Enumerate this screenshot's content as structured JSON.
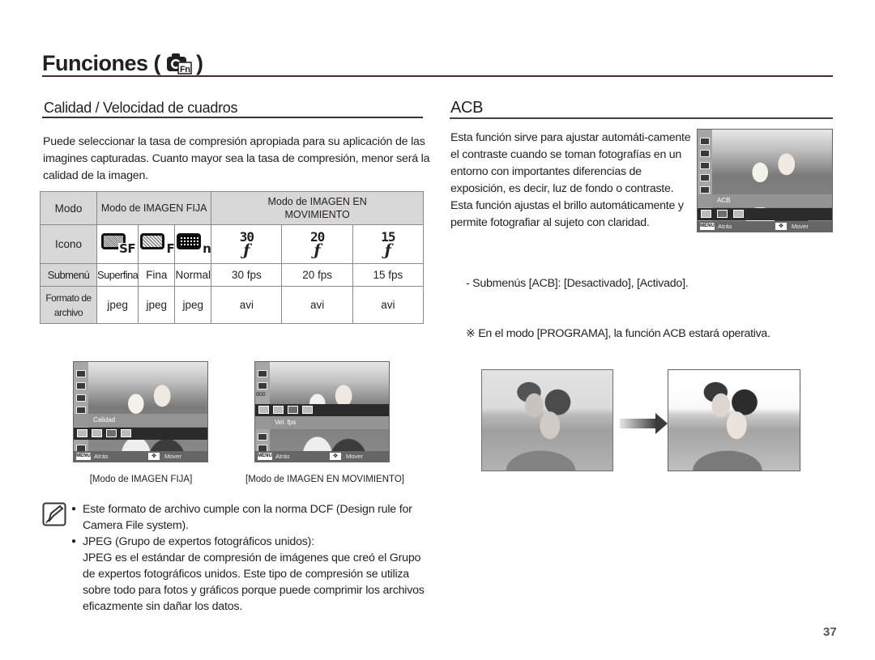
{
  "header": {
    "title": "Funciones (",
    "title_close": ")",
    "icon": "camera-fn-icon"
  },
  "section_quality": {
    "title": "Calidad / Velocidad de cuadros",
    "intro": "Puede seleccionar la tasa de compresión apropiada para su aplicación de las imagines capturadas. Cuanto mayor sea la tasa de compresión, menor será la calidad de la imagen.",
    "table": {
      "row_labels": {
        "mode": "Modo",
        "icon": "Icono",
        "submenu": "Submenú",
        "format": "Formato de archivo"
      },
      "groups": [
        {
          "label": "Modo de IMAGEN FIJA"
        },
        {
          "label": "Modo de IMAGEN EN MOVIMIENTO"
        }
      ],
      "columns": [
        {
          "icon": "superfine-quality-icon",
          "icon_suffix": "SF",
          "submenu": "Superfina",
          "format": "jpeg"
        },
        {
          "icon": "fine-quality-icon",
          "icon_suffix": "F",
          "submenu": "Fina",
          "format": "jpeg"
        },
        {
          "icon": "normal-quality-icon",
          "icon_suffix": "n",
          "submenu": "Normal",
          "format": "jpeg"
        },
        {
          "icon": "fps-30-icon",
          "icon_num": "30",
          "submenu": "30 fps",
          "format": "avi"
        },
        {
          "icon": "fps-20-icon",
          "icon_num": "20",
          "submenu": "20 fps",
          "format": "avi"
        },
        {
          "icon": "fps-15-icon",
          "icon_num": "15",
          "submenu": "15 fps",
          "format": "avi"
        }
      ]
    },
    "screens": [
      {
        "menu_label": "Calidad",
        "back": "Atrás",
        "move": "Mover",
        "menu_key": "MENU",
        "caption": "[Modo de IMAGEN FIJA]"
      },
      {
        "menu_label": "Vel. fps",
        "back": "Atrás",
        "move": "Mover",
        "menu_key": "MENU",
        "side_value": "800",
        "caption": "[Modo de IMAGEN EN MOVIMIENTO]"
      }
    ],
    "notes": [
      {
        "text": "Este formato de archivo cumple con la norma DCF (Design rule for Camera File system)."
      },
      {
        "text": "JPEG (Grupo de expertos fotográficos unidos):",
        "detail": "JPEG es el estándar de compresión de imágenes que creó el Grupo de expertos fotográficos unidos. Este tipo de compresión se utiliza sobre todo para fotos y gráficos porque puede comprimir los archivos eficazmente sin dañar los datos."
      }
    ]
  },
  "section_acb": {
    "title": "ACB",
    "description": "Esta función sirve para ajustar automáti-camente el contraste cuando se toman fotografías en un entorno con importantes diferencias de exposición, es decir, luz de fondo o contraste. Esta función ajustas el brillo automáticamente y permite fotografiar al sujeto con claridad.",
    "screen": {
      "menu_label": "ACB",
      "back": "Atrás",
      "move": "Mover",
      "menu_key": "MENU"
    },
    "submenu_line": "- Submenús [ACB]: [Desactivado], [Activado].",
    "note_line": "※ En el modo [PROGRAMA], la función ACB estará operativa."
  },
  "page_number": "37"
}
